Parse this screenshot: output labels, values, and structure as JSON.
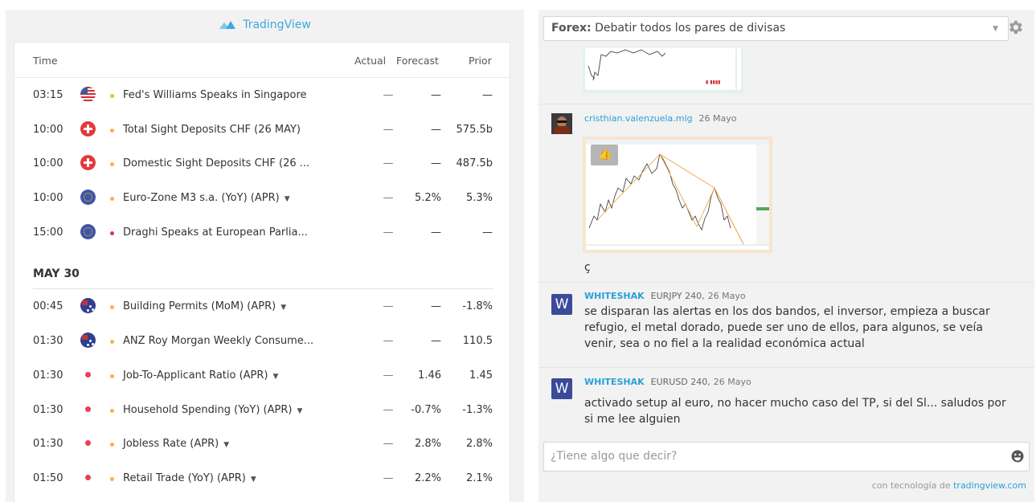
{
  "calendar": {
    "brand": "TradingView",
    "columns": {
      "time": "Time",
      "actual": "Actual",
      "forecast": "Forecast",
      "prior": "Prior"
    },
    "rows_group1": [
      {
        "time": "03:15",
        "flag": "us-flag-icon",
        "dot": "#f6b43c",
        "title": "Fed's Williams Speaks in Singapore",
        "has_caret": false,
        "actual": "—",
        "forecast": "—",
        "prior": "—"
      },
      {
        "time": "10:00",
        "flag": "ch-flag-icon",
        "dot": "#f6b43c",
        "title": "Total Sight Deposits CHF (26 MAY)",
        "has_caret": false,
        "actual": "—",
        "forecast": "—",
        "prior": "575.5b"
      },
      {
        "time": "10:00",
        "flag": "ch-flag-icon",
        "dot": "#f6b43c",
        "title": "Domestic Sight Deposits CHF (26 ...",
        "has_caret": false,
        "actual": "—",
        "forecast": "—",
        "prior": "487.5b"
      },
      {
        "time": "10:00",
        "flag": "eu-flag-icon",
        "dot": "#f6b43c",
        "title": "Euro-Zone M3 s.a. (YoY) (APR)",
        "has_caret": true,
        "actual": "—",
        "forecast": "5.2%",
        "prior": "5.3%"
      },
      {
        "time": "15:00",
        "flag": "eu-flag-icon",
        "dot": "#e0334a",
        "title": "Draghi Speaks at European Parlia...",
        "has_caret": false,
        "actual": "—",
        "forecast": "—",
        "prior": "—"
      }
    ],
    "date_header": "MAY 30",
    "rows_group2": [
      {
        "time": "00:45",
        "flag": "au-flag-icon",
        "dot": "#f6b43c",
        "title": "Building Permits (MoM) (APR)",
        "has_caret": true,
        "actual": "—",
        "forecast": "—",
        "prior": "-1.8%"
      },
      {
        "time": "01:30",
        "flag": "au-flag-icon",
        "dot": "#f6b43c",
        "title": "ANZ Roy Morgan Weekly Consume...",
        "has_caret": false,
        "actual": "—",
        "forecast": "—",
        "prior": "110.5"
      },
      {
        "time": "01:30",
        "flag": "jp-flag-icon",
        "dot": "#f6b43c",
        "title": "Job-To-Applicant Ratio (APR)",
        "has_caret": true,
        "actual": "—",
        "forecast": "1.46",
        "prior": "1.45"
      },
      {
        "time": "01:30",
        "flag": "jp-flag-icon",
        "dot": "#f6b43c",
        "title": "Household Spending (YoY) (APR)",
        "has_caret": true,
        "actual": "—",
        "forecast": "-0.7%",
        "prior": "-1.3%"
      },
      {
        "time": "01:30",
        "flag": "jp-flag-icon",
        "dot": "#f6b43c",
        "title": "Jobless Rate (APR)",
        "has_caret": true,
        "actual": "—",
        "forecast": "2.8%",
        "prior": "2.8%"
      },
      {
        "time": "01:50",
        "flag": "jp-flag-icon",
        "dot": "#f6b43c",
        "title": "Retail Trade (YoY) (APR)",
        "has_caret": true,
        "actual": "—",
        "forecast": "2.2%",
        "prior": "2.1%"
      }
    ]
  },
  "chat": {
    "room_label": "Forex:",
    "room_name": "Debatir todos los pares de divisas",
    "messages": [
      {
        "user": "cristhian.valenzuela.mlg",
        "pair": "",
        "date": "26 Mayo",
        "text": "ç"
      },
      {
        "user": "WHITESHAK",
        "pair": "EURJPY 240,",
        "date": "26 Mayo",
        "text": "se disparan las alertas en los dos bandos, el inversor, empieza a buscar refugio, el metal dorado, puede ser uno de ellos, para algunos, se veía venir, sea o no fiel a la realidad económica actual"
      },
      {
        "user": "WHITESHAK",
        "pair": "EURUSD 240,",
        "date": "26 Mayo",
        "text": "activado setup al euro, no hacer mucho caso del TP, si del Sl... saludos por si me lee alguien"
      }
    ],
    "avatar_letter": "W",
    "input_placeholder": "¿Tiene algo que decir?",
    "footer_prefix": "con tecnología de",
    "footer_link": "tradingview.com"
  }
}
